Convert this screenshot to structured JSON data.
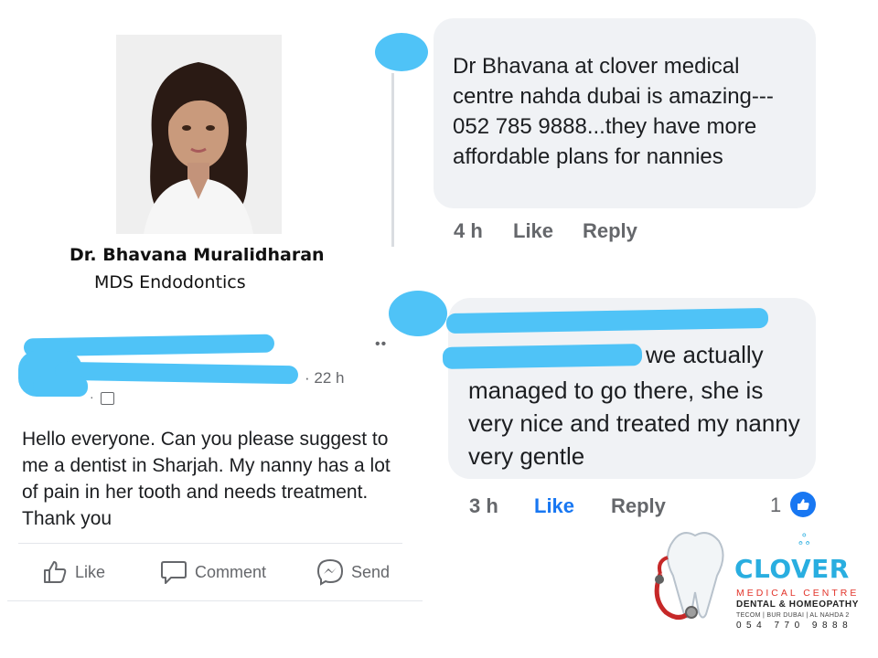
{
  "doctor": {
    "name": "Dr. Bhavana Muralidharan",
    "title": "MDS Endodontics"
  },
  "post": {
    "time": "· 22 h",
    "audience_dot": "·",
    "menu": "••",
    "text": "Hello everyone. Can you please suggest to me a dentist in Sharjah. My nanny has a lot of pain in her tooth and needs treatment. Thank you",
    "actions": {
      "like": "Like",
      "comment": "Comment",
      "send": "Send"
    }
  },
  "comment1": {
    "text": "Dr Bhavana at clover medical centre nahda dubai is amazing--- 052 785 9888...they have more affordable plans for nannies",
    "time": "4 h",
    "like": "Like",
    "reply": "Reply"
  },
  "comment2": {
    "text_first": "we actually",
    "text": "managed to go there, she is very nice and treated my nanny very gentle",
    "time": "3 h",
    "like": "Like",
    "reply": "Reply",
    "reaction_count": "1"
  },
  "logo": {
    "name": "CLOVER",
    "line1": "MEDICAL CENTRE",
    "line2": "DENTAL & HOMEOPATHY",
    "line3": "TECOM | BUR DUBAI | AL NAHDA 2",
    "phone": "054 770 9888"
  },
  "colors": {
    "accent": "#1877f2",
    "redaction": "#4fc3f7",
    "bubble": "#f0f2f5",
    "logo_blue": "#29aee0",
    "logo_red": "#e2352b"
  }
}
